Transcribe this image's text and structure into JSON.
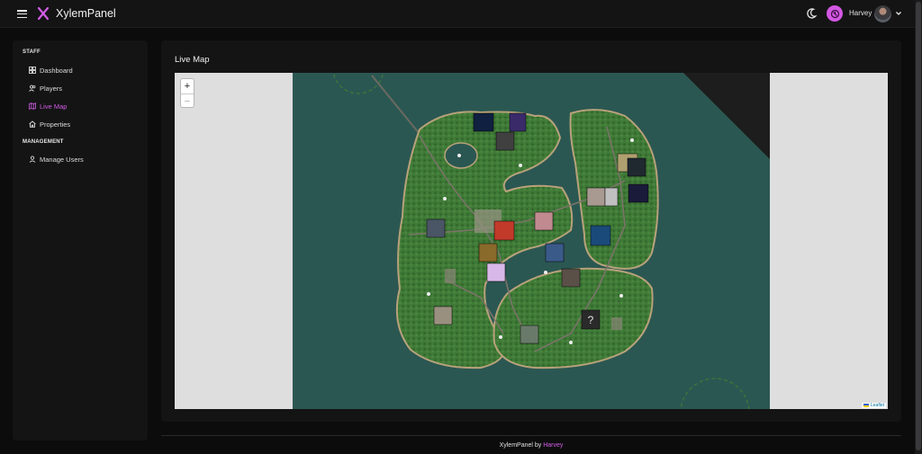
{
  "app": {
    "title": "XylemPanel"
  },
  "header": {
    "user_name": "Harvey"
  },
  "sidebar": {
    "sections": [
      {
        "label": "STAFF",
        "items": [
          {
            "label": "Dashboard",
            "icon": "grid-icon"
          },
          {
            "label": "Players",
            "icon": "users-icon"
          },
          {
            "label": "Live Map",
            "icon": "map-icon",
            "active": true
          },
          {
            "label": "Properties",
            "icon": "home-icon"
          }
        ]
      },
      {
        "label": "MANAGEMENT",
        "items": [
          {
            "label": "Manage Users",
            "icon": "user-icon"
          }
        ]
      }
    ]
  },
  "main": {
    "title": "Live Map",
    "map": {
      "zoom_in": "+",
      "zoom_out": "−",
      "attribution": "Leaflet"
    }
  },
  "footer": {
    "text": "XylemPanel by",
    "author": "Harvey"
  },
  "colors": {
    "accent": "#d45de6",
    "sea": "#2b5752",
    "land": "#3f7a37",
    "background": "#0c0c0d",
    "surface": "#141415"
  }
}
